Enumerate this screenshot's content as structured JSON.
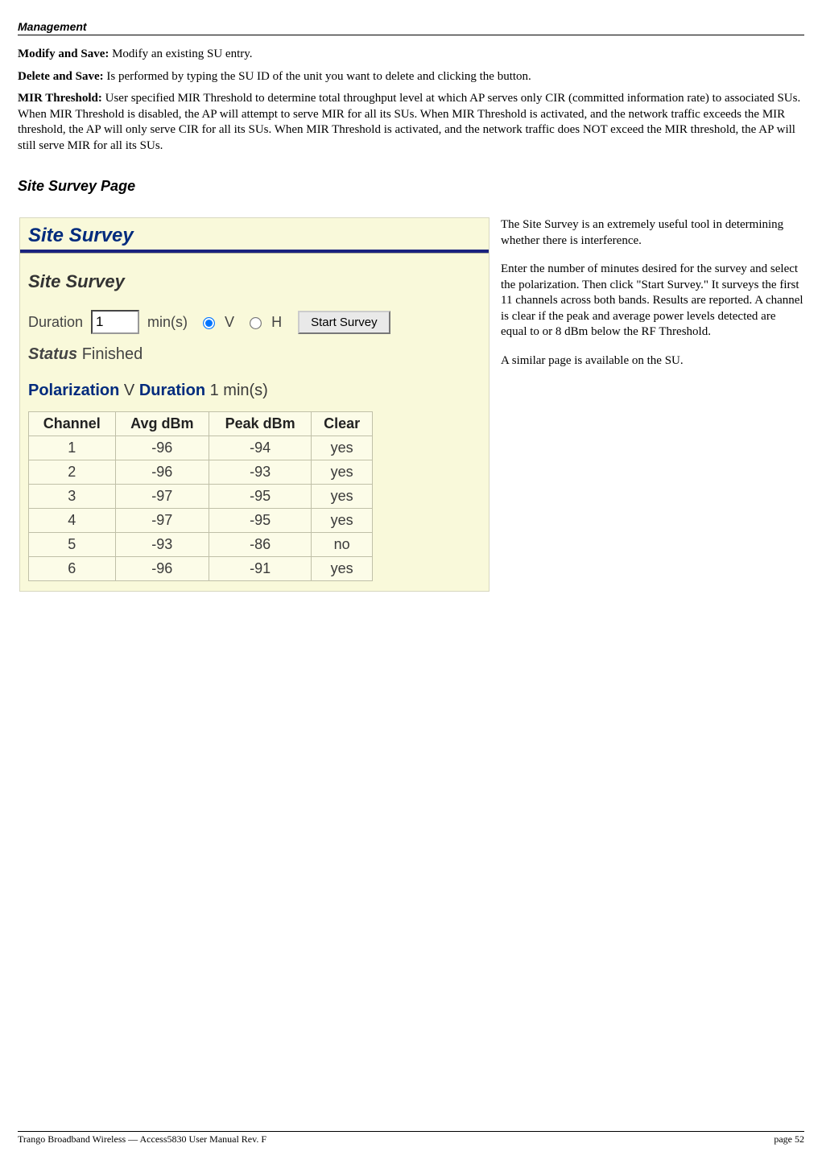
{
  "header": "Management",
  "paragraphs": {
    "modify": {
      "label": "Modify and Save:",
      "text": "  Modify an existing SU entry."
    },
    "delete": {
      "label": "Delete and Save:",
      "text": "  Is performed by typing the SU ID of the unit you want to delete and clicking the button."
    },
    "mir": {
      "label": "MIR Threshold:",
      "text": "  User specified MIR Threshold to determine total throughput level at which AP serves only CIR (committed information rate) to associated SUs.  When MIR Threshold is disabled, the AP will attempt to serve MIR for all its SUs.  When MIR Threshold is activated, and the network traffic exceeds the MIR threshold, the AP will only serve CIR for all its SUs.  When MIR Threshold is activated, and the network traffic does NOT exceed the MIR threshold, the AP will still serve MIR for all its SUs."
    }
  },
  "section_heading": "Site Survey Page",
  "survey": {
    "title": "Site Survey",
    "subtitle": "Site Survey",
    "duration_label": "Duration",
    "duration_value": "1",
    "mins_label": "min(s)",
    "pol_v": "V",
    "pol_h": "H",
    "start_button": "Start Survey",
    "status_label": "Status",
    "status_value": "Finished",
    "polarization_label": "Polarization",
    "polarization_value": "V",
    "result_duration_label": "Duration",
    "result_duration_value": "1 min(s)",
    "columns": {
      "c1": "Channel",
      "c2": "Avg dBm",
      "c3": "Peak dBm",
      "c4": "Clear"
    },
    "rows": [
      {
        "ch": "1",
        "avg": "-96",
        "peak": "-94",
        "clear": "yes"
      },
      {
        "ch": "2",
        "avg": "-96",
        "peak": "-93",
        "clear": "yes"
      },
      {
        "ch": "3",
        "avg": "-97",
        "peak": "-95",
        "clear": "yes"
      },
      {
        "ch": "4",
        "avg": "-97",
        "peak": "-95",
        "clear": "yes"
      },
      {
        "ch": "5",
        "avg": "-93",
        "peak": "-86",
        "clear": "no"
      },
      {
        "ch": "6",
        "avg": "-96",
        "peak": "-91",
        "clear": "yes"
      }
    ]
  },
  "aside": {
    "p1": "The Site Survey is an extremely useful tool in determining whether there is interference.",
    "p2": "Enter the number of minutes desired for the survey and select the polarization.  Then click \"Start Survey.\"  It surveys the first 11 channels across both bands.  Results are reported.  A channel is clear if the peak and average power levels detected are equal to or 8 dBm below the RF Threshold.",
    "p3": "A similar page is available on the SU."
  },
  "footer": {
    "left": "Trango Broadband Wireless — Access5830 User Manual  Rev. F",
    "right": "page 52"
  },
  "chart_data": {
    "type": "table",
    "title": "Site Survey Results",
    "columns": [
      "Channel",
      "Avg dBm",
      "Peak dBm",
      "Clear"
    ],
    "rows": [
      [
        1,
        -96,
        -94,
        "yes"
      ],
      [
        2,
        -96,
        -93,
        "yes"
      ],
      [
        3,
        -97,
        -95,
        "yes"
      ],
      [
        4,
        -97,
        -95,
        "yes"
      ],
      [
        5,
        -93,
        -86,
        "no"
      ],
      [
        6,
        -96,
        -91,
        "yes"
      ]
    ]
  }
}
